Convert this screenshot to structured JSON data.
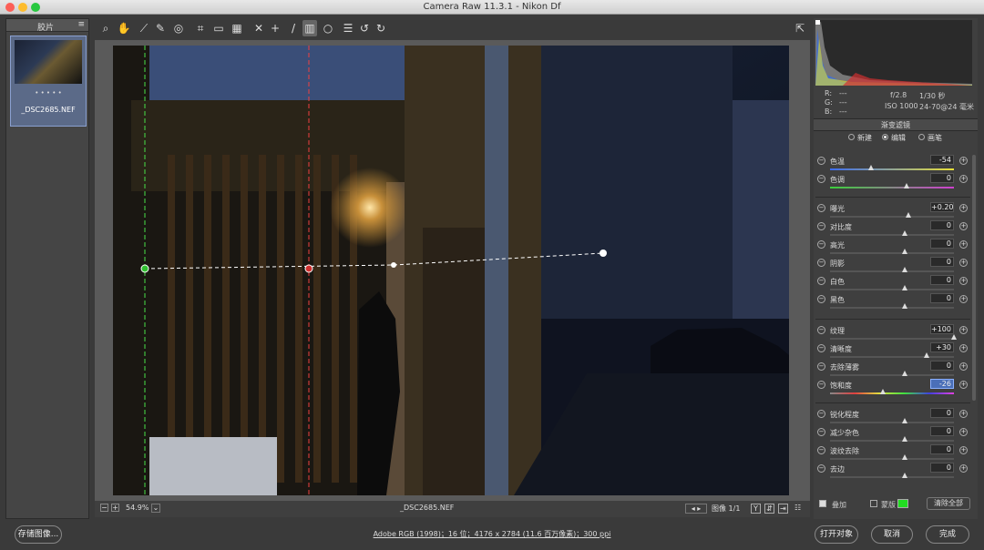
{
  "window": {
    "title": "Camera Raw 11.3.1 -  Nikon Df"
  },
  "filmstrip": {
    "title": "胶片",
    "filename": "_DSC2685.NEF",
    "rating_dots": "• • • • •"
  },
  "statusbar": {
    "zoom": "54.9%",
    "filename": "_DSC2685.NEF",
    "image_count": "图像 1/1"
  },
  "info": {
    "r": "R:",
    "g": "G:",
    "b": "B:",
    "dashes": "---",
    "aperture": "f/2.8",
    "shutter": "1/30 秒",
    "iso": "ISO 1000",
    "lens": "24-70@24 毫米"
  },
  "panel": {
    "title": "渐变滤镜",
    "modes": [
      "新建",
      "编辑",
      "画笔"
    ],
    "selected_mode": "编辑"
  },
  "sliders": [
    {
      "label": "色温",
      "value": "-54",
      "pos": 0.33,
      "gradient": "linear-gradient(90deg,#3c6cf0,#e8e038)"
    },
    {
      "label": "色调",
      "value": "0",
      "pos": 0.62,
      "gradient": "linear-gradient(90deg,#3bd03b,#d040d0)"
    },
    {
      "label": "曝光",
      "value": "+0.20",
      "pos": 0.63
    },
    {
      "label": "对比度",
      "value": "0",
      "pos": 0.6
    },
    {
      "label": "高光",
      "value": "0",
      "pos": 0.6
    },
    {
      "label": "阴影",
      "value": "0",
      "pos": 0.6
    },
    {
      "label": "白色",
      "value": "0",
      "pos": 0.6
    },
    {
      "label": "黑色",
      "value": "0",
      "pos": 0.6
    },
    {
      "label": "纹理",
      "value": "+100",
      "pos": 1.0
    },
    {
      "label": "清晰度",
      "value": "+30",
      "pos": 0.78
    },
    {
      "label": "去除薄雾",
      "value": "0",
      "pos": 0.6
    },
    {
      "label": "饱和度",
      "value": "-26",
      "pos": 0.43,
      "gradient": "linear-gradient(90deg,#888,#e04040,#e0e040,#40e040,#4040e0,#e040e0)",
      "highlight": true
    },
    {
      "label": "锐化程度",
      "value": "0",
      "pos": 0.6
    },
    {
      "label": "减少杂色",
      "value": "0",
      "pos": 0.6
    },
    {
      "label": "波纹去除",
      "value": "0",
      "pos": 0.6
    },
    {
      "label": "去边",
      "value": "0",
      "pos": 0.6
    }
  ],
  "overlay": {
    "label": "叠加",
    "mask_label": "蒙版",
    "mask_color": "#22dd22",
    "clear_all": "清除全部"
  },
  "bottom": {
    "save": "存储图像...",
    "workflow_link": "Adobe RGB (1998)；16 位；4176 x 2784 (11.6 百万像素)；300 ppi",
    "open": "打开对象",
    "cancel": "取消",
    "done": "完成"
  },
  "colors": {
    "accent": "#6b8fd6",
    "mask": "#22dd22"
  }
}
